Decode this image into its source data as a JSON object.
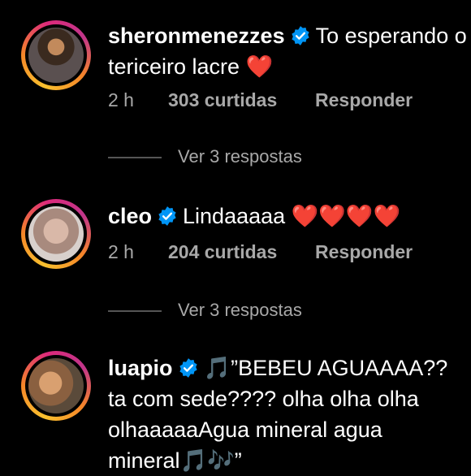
{
  "comments": [
    {
      "username": "sheronmenezzes",
      "text_line1": "To esperando o",
      "text_line2": "tericeiro lacre",
      "hearts": "❤️",
      "time": "2 h",
      "likes": "303 curtidas",
      "reply_label": "Responder",
      "view_replies": "Ver 3 respostas"
    },
    {
      "username": "cleo",
      "text_line1": "Lindaaaaa",
      "hearts": "❤️❤️❤️❤️",
      "time": "2 h",
      "likes": "204 curtidas",
      "reply_label": "Responder",
      "view_replies": "Ver 3 respostas"
    },
    {
      "username": "luapio",
      "music_note_1": "🎵",
      "text_line1": "”BEBEU AGUAAAA??",
      "text_line2": "ta com sede???? olha olha olha",
      "text_line3": "olhaaaaaAgua mineral agua",
      "text_line4": "mineral",
      "music_note_2": "🎵🎶",
      "text_end": "”"
    }
  ],
  "colors": {
    "background": "#000000",
    "verified_badge": "#0095f6",
    "secondary_text": "#a8a8a8",
    "heart": "#ff1f3d"
  }
}
